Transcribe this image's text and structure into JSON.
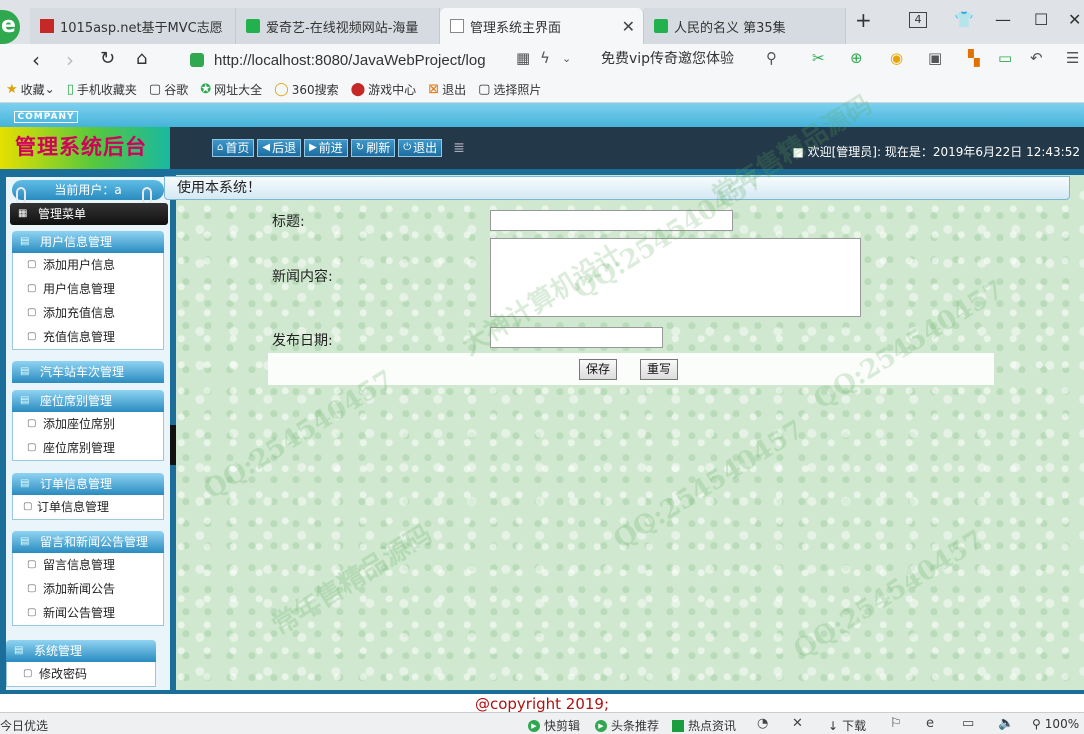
{
  "browser": {
    "tabs": [
      {
        "title": "1015asp.net基于MVC志愿",
        "favicon": "red"
      },
      {
        "title": "爱奇艺-在线视频网站-海量",
        "favicon": "iqiyi"
      },
      {
        "title": "管理系统主界面",
        "favicon": "page",
        "active": true
      },
      {
        "title": "人民的名义 第35集",
        "favicon": "iqiyi"
      }
    ],
    "tab_count": "4",
    "url": "http://localhost:8080/JavaWebProject/log",
    "promo_text": "免费vip传奇邀您体验",
    "bookmarks": [
      {
        "label": "收藏",
        "icon": "star-icon"
      },
      {
        "label": "手机收藏夹",
        "icon": "phone-icon"
      },
      {
        "label": "谷歌",
        "icon": "page-icon"
      },
      {
        "label": "网址大全",
        "icon": "compass-icon"
      },
      {
        "label": "360搜索",
        "icon": "search-icon"
      },
      {
        "label": "游戏中心",
        "icon": "game-icon"
      },
      {
        "label": "退出",
        "icon": "exit-icon"
      },
      {
        "label": "选择照片",
        "icon": "page-icon"
      }
    ],
    "status": {
      "left_text": "今日优选",
      "items": [
        "快剪辑",
        "头条推荐",
        "热点资讯",
        "下载"
      ],
      "zoom": "100%"
    }
  },
  "app": {
    "company_badge": "COMPANY",
    "brand_title": "管理系统后台",
    "toolbar": [
      {
        "label": "首页",
        "icon": "home-icon"
      },
      {
        "label": "后退",
        "icon": "arrow-left-icon"
      },
      {
        "label": "前进",
        "icon": "arrow-right-icon"
      },
      {
        "label": "刷新",
        "icon": "refresh-icon"
      },
      {
        "label": "退出",
        "icon": "power-icon"
      }
    ],
    "welcome": "■ 欢迎[管理员]:  现在是：2019年6月22日 12:43:52",
    "sidebar": {
      "current_user": "当前用户：a",
      "menu_title": "管理菜单",
      "groups": [
        {
          "title": "用户信息管理",
          "items": [
            "添加用户信息",
            "用户信息管理",
            "添加充值信息",
            "充值信息管理"
          ]
        },
        {
          "title": "汽车站车次管理",
          "items": []
        },
        {
          "title": "座位席别管理",
          "items": [
            "添加座位席别",
            "座位席别管理"
          ]
        },
        {
          "title": "订单信息管理",
          "items": [
            "订单信息管理"
          ]
        },
        {
          "title": "留言和新闻公告管理",
          "items": [
            "留言信息管理",
            "添加新闻公告",
            "新闻公告管理"
          ]
        },
        {
          "title": "系统管理",
          "items": [
            "修改密码"
          ]
        }
      ]
    },
    "notice": "使用本系统！",
    "form": {
      "title_label": "标题:",
      "title_value": "",
      "content_label": "新闻内容:",
      "content_value": "",
      "date_label": "发布日期:",
      "date_value": "",
      "save_label": "保存",
      "reset_label": "重写"
    },
    "copyright": "@copyright 2019;"
  },
  "watermark": {
    "lines": [
      "QQ:254540457",
      "大神计算机设计",
      "常年售精品源码"
    ]
  }
}
